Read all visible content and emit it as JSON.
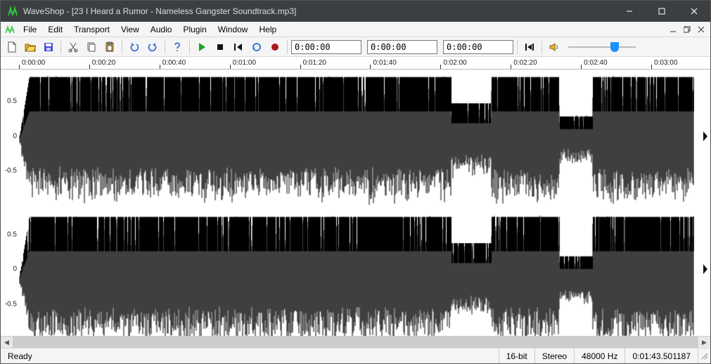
{
  "title": "WaveShop - [23 I Heard a Rumor - Nameless Gangster Soundtrack.mp3]",
  "menu": {
    "items": [
      "File",
      "Edit",
      "Transport",
      "View",
      "Audio",
      "Plugin",
      "Window",
      "Help"
    ]
  },
  "toolbar": {
    "time1": "0:00:00",
    "time2": "0:00:00",
    "time3": "0:00:00",
    "volume_pct": 72
  },
  "ruler": {
    "ticks": [
      "0:00:00",
      "0:00:20",
      "0:00:40",
      "0:01:00",
      "0:01:20",
      "0:01:40",
      "0:02:00",
      "0:02:20",
      "0:02:40",
      "0:03:00"
    ]
  },
  "yaxis": {
    "labels": [
      "0.5",
      "0",
      "-0.5"
    ]
  },
  "status": {
    "ready": "Ready",
    "bits": "16-bit",
    "channels": "Stereo",
    "rate": "48000 Hz",
    "pos": "0:01:43.501187"
  },
  "colors": {
    "titlebar": "#3c3f41",
    "accent": "#1e90ff",
    "play": "#1aa321",
    "record": "#b01818",
    "folder": "#e7b534",
    "save": "#4b4bd8"
  }
}
